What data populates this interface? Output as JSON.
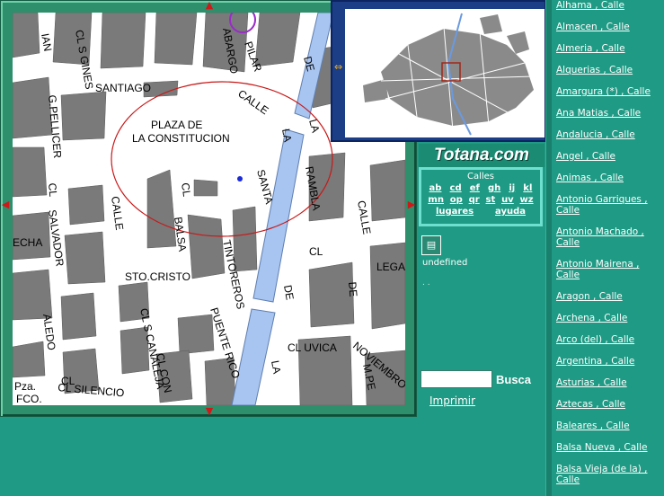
{
  "map": {
    "labels": {
      "plaza_line1": "PLAZA DE",
      "plaza_line2": "LA CONSTITUCION",
      "santiago": "SANTIAGO",
      "calle_top": "CALLE",
      "pilar": "PILAR",
      "abargo": "ABARGO",
      "cl_s_gines": "CL S GINES",
      "ian": "IAN",
      "g_pellicer": "G.PELLICER",
      "cl_left": "CL",
      "echa": "ECHA",
      "salvador": "SALVADOR",
      "calle_left": "CALLE",
      "cl_mid": "CL",
      "balsa": "BALSA",
      "tintoreros": "TINTOREROS",
      "sto_cristo": "STO.CRISTO",
      "santa": "SANTA",
      "rambla": "RAMBLA",
      "la_mid": "LA",
      "de_top": "DE",
      "la_top": "LA",
      "calle_right": "CALLE",
      "cl_right": "CL",
      "lega": "LEGA",
      "de_mid": "DE",
      "de_right": "DE",
      "aledo": "ALEDO",
      "cl_s_canaleja": "CL S CANALEJA",
      "puente_rico": "PUENTE RICO",
      "cl_uvica": "CL UVICA",
      "novembro": "NOVIEMBRO",
      "cl_silencio": "CL SILENCIO",
      "cl_con": "CL CON",
      "la_bottom": "LA",
      "m_pe": "M.PE",
      "pza": "Pza.",
      "fco": "FCO.",
      "cl_bottom_left": "CL"
    }
  },
  "logo": {
    "text": "Totana.com"
  },
  "index": {
    "title": "Calles",
    "row1": [
      "ab",
      "cd",
      "ef",
      "gh",
      "ij",
      "kl"
    ],
    "row2": [
      "mn",
      "op",
      "qr",
      "st",
      "uv",
      "wz"
    ],
    "row3": [
      "lugares",
      "ayuda"
    ]
  },
  "misc": {
    "legend_icon": "legend-icon",
    "undefined_label": "undefined",
    "dots": ". ."
  },
  "search": {
    "button_label": "Busca",
    "value": ""
  },
  "print": {
    "label": "Imprimir"
  },
  "streets": [
    "Alhama , Calle",
    "Almacen , Calle",
    "Almeria , Calle",
    "Alquerias , Calle",
    "Amargura (*) , Calle",
    "Ana Matias , Calle",
    "Andalucia , Calle",
    "Angel , Calle",
    "Animas , Calle",
    "Antonio Garriques , Calle",
    "Antonio Machado , Calle",
    "Antonio Mairena , Calle",
    "Aragon , Calle",
    "Archena , Calle",
    "Arco (del) , Calle",
    "Argentina , Calle",
    "Asturias , Calle",
    "Aztecas , Calle",
    "Baleares , Calle",
    "Balsa Nueva , Calle",
    "Balsa Vieja (de la) , Calle"
  ],
  "colors": {
    "background": "#1f9a84",
    "frame": "#2d8f6c",
    "block_fill": "#7a7a7a",
    "water": "#a8c4f0",
    "circle": "#c81818",
    "overview_frame": "#1b3e86"
  }
}
